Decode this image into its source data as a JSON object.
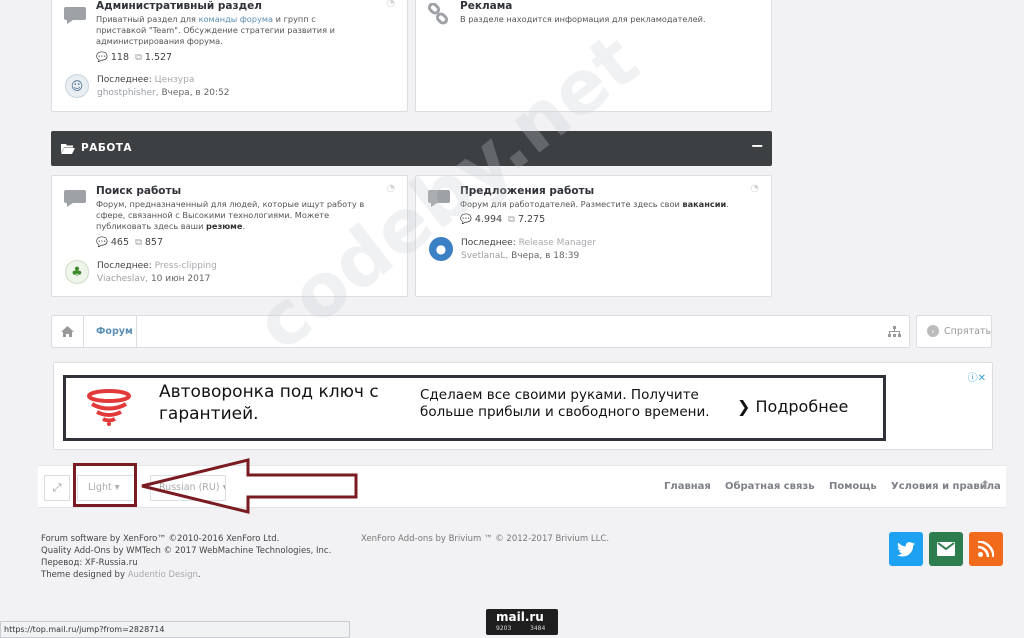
{
  "forum_top": [
    {
      "title": "Административный раздел",
      "desc_pre": "Приватный раздел для ",
      "desc_link": "команды форума",
      "desc_post": " и групп с приставкой \"Team\". Обсуждение стратегии развития и администрирования форума.",
      "threads": "118",
      "posts": "1.527",
      "last_label": "Последнее:",
      "last_thread": "Цензура",
      "last_user": "ghostphisher",
      "last_time": "Вчера, в 20:52"
    },
    {
      "title": "Реклама",
      "desc": "В разделе находится информация для рекламодателей."
    }
  ],
  "category": {
    "title": "РАБОТА",
    "collapse": "−"
  },
  "forums": [
    {
      "title": "Поиск работы",
      "desc_pre": "Форум, предназначенный для людей, которые ищут работу в сфере, связанной с Высокими технологиями. Можете публиковать здесь ваши ",
      "desc_bold": "резюме",
      "desc_post": ".",
      "threads": "465",
      "posts": "857",
      "last_label": "Последнее:",
      "last_thread": "Press-clipping",
      "last_user": "Viacheslav",
      "last_time": "10 июн 2017"
    },
    {
      "title": "Предложения работы",
      "desc_pre": "Форум для работодателей. Разместите здесь свои ",
      "desc_bold": "вакансии",
      "desc_post": ".",
      "threads": "4.994",
      "posts": "7.275",
      "last_label": "Последнее:",
      "last_thread": "Release Manager",
      "last_user": "SvetlanaL",
      "last_time": "Вчера, в 18:39"
    }
  ],
  "breadcrumb": {
    "current": "Форум",
    "hide": "Спрятать"
  },
  "ad": {
    "headline": "Автоворонка под ключ с гарантией.",
    "body": "Сделаем все своими руками. Получите больше прибыли и свободного времени.",
    "cta": "Подробнее"
  },
  "footer_bar": {
    "style": "Light",
    "language": "Russian (RU)",
    "links": [
      "Главная",
      "Обратная связь",
      "Помощь",
      "Условия и правила"
    ]
  },
  "copyright": {
    "lines": [
      "Forum software by XenForo™ ©2010-2016 XenForo Ltd.",
      "Quality Add-Ons by WMTech © 2017 WebMachine Technologies, Inc.",
      "Перевод: XF-Russia.ru"
    ],
    "theme_pre": "Theme designed by ",
    "theme_link": "Audentio Design",
    "theme_suffix": ".",
    "brivium": "XenForo Add-ons by Brivium ™ © 2012-2017 Brivium LLC."
  },
  "watermark": "codeby.net",
  "mailru": {
    "logo": "mail.ru",
    "count1": "9203",
    "count2": "3484"
  },
  "status_url": "https://top.mail.ru/jump?from=2828714",
  "colors": {
    "twitter": "#1da1f2",
    "email": "#2e7d4f",
    "rss": "#f26a1b",
    "category_bar": "#3d4043",
    "annotation": "#7a1b22"
  }
}
